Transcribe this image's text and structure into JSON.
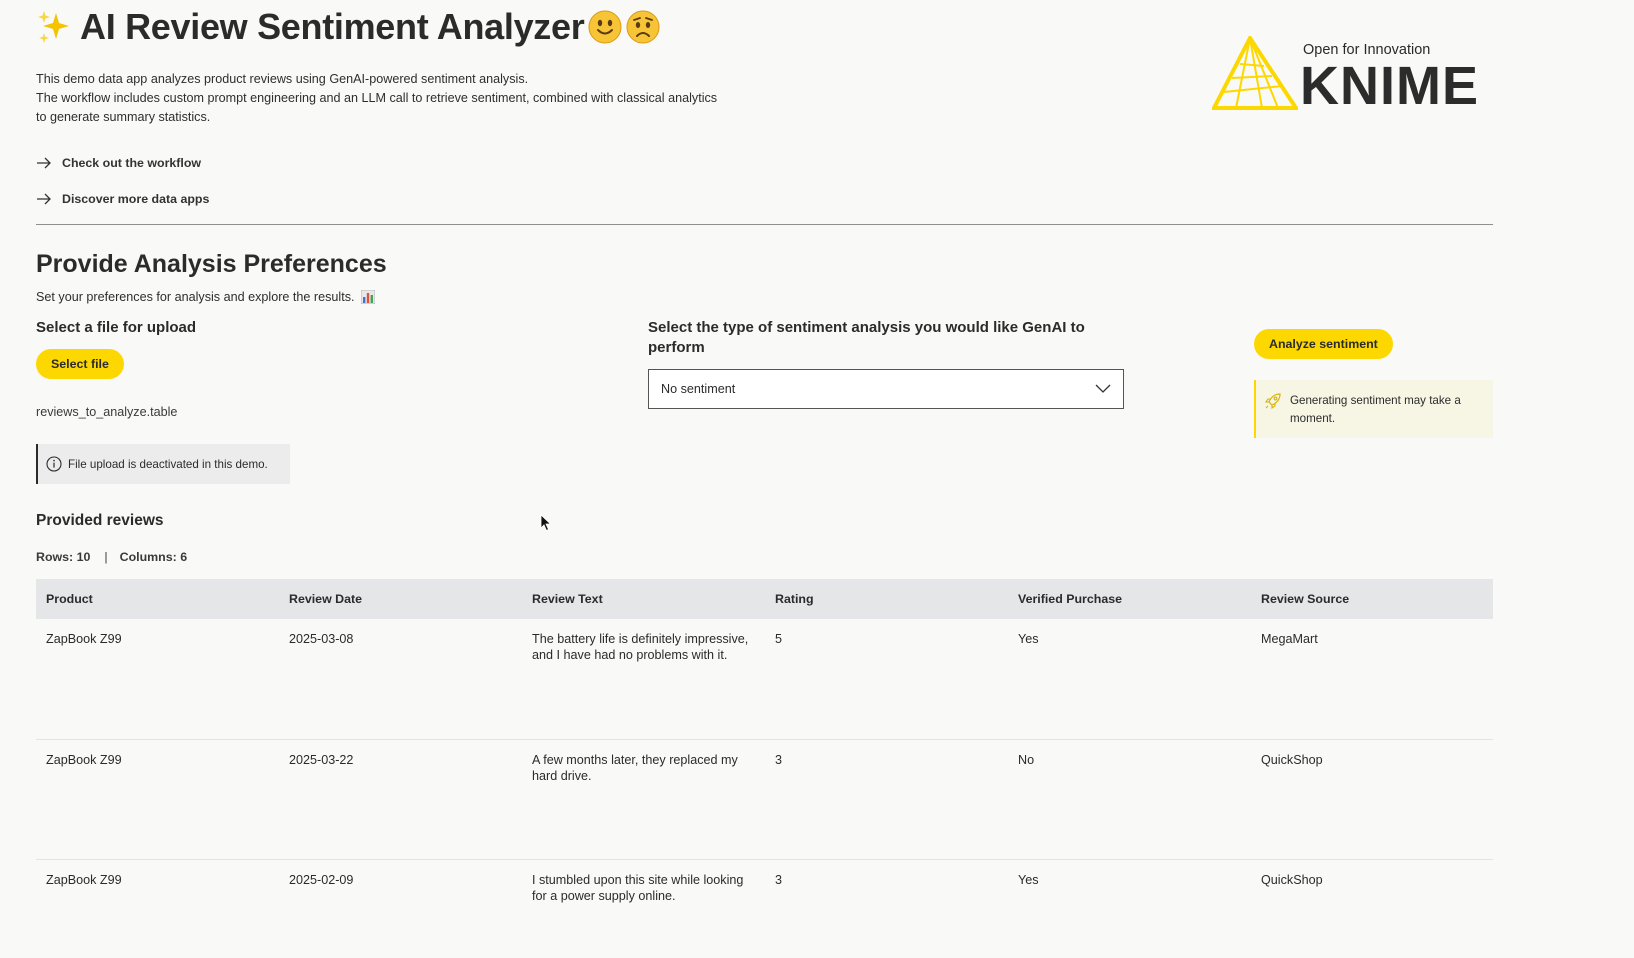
{
  "header": {
    "title": "AI Review Sentiment Analyzer",
    "intro_lines": [
      "This demo data app analyzes product reviews using GenAI-powered sentiment analysis.",
      "The workflow includes custom prompt engineering and an LLM call to retrieve sentiment, combined with classical analytics",
      "to generate summary statistics."
    ],
    "links": [
      "Check out the workflow",
      "Discover more data apps"
    ]
  },
  "logo": {
    "tagline": "Open for Innovation",
    "wordmark": "KNIME",
    "accent_color": "#fdd800"
  },
  "preferences": {
    "title": "Provide Analysis Preferences",
    "subtitle": "Set your preferences for analysis and explore the results.",
    "upload_label": "Select a file for upload",
    "select_file_button": "Select file",
    "file_name": "reviews_to_analyze.table",
    "upload_info": "File upload is deactivated in this demo.",
    "sentiment_label": "Select the type of sentiment analysis you would like GenAI to perform",
    "sentiment_selected": "No sentiment",
    "analyze_button": "Analyze sentiment",
    "notice": "Generating sentiment may take a moment."
  },
  "reviews": {
    "title": "Provided reviews",
    "rows_label": "Rows: 10",
    "cols_label": "Columns: 6",
    "columns": [
      "Product",
      "Review Date",
      "Review Text",
      "Rating",
      "Verified Purchase",
      "Review Source"
    ],
    "rows": [
      [
        "ZapBook Z99",
        "2025-03-08",
        "The battery life is definitely impressive, and I have had no problems with it.",
        "5",
        "Yes",
        "MegaMart"
      ],
      [
        "ZapBook Z99",
        "2025-03-22",
        "A few months later, they replaced my hard drive.",
        "3",
        "No",
        "QuickShop"
      ],
      [
        "ZapBook Z99",
        "2025-02-09",
        "I stumbled upon this site while looking for a power supply online.",
        "3",
        "Yes",
        "QuickShop"
      ]
    ]
  },
  "icons": {
    "title_left": "sparkles-icon",
    "title_emojis": [
      "slightly-smiling-face-icon",
      "worried-face-icon"
    ],
    "link_arrow": "arrow-right-icon",
    "subtitle_icon": "bar-chart-icon",
    "info_icon": "info-circle-icon",
    "dropdown_icon": "chevron-down-icon",
    "notice_icon": "rocket-icon",
    "pointer": "mouse-pointer-icon"
  }
}
